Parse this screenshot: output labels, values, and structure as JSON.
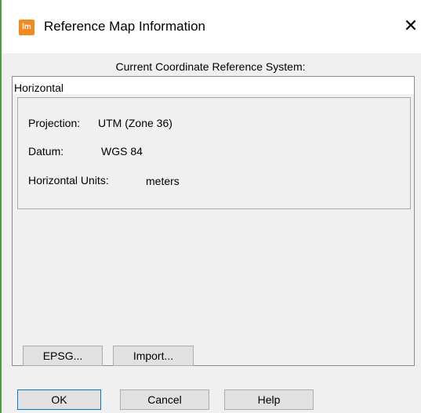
{
  "window": {
    "title": "Reference Map Information",
    "app_icon_text": "lm",
    "app_icon_color": "#f28a1e",
    "close_glyph": "✕"
  },
  "crs": {
    "caption": "Current Coordinate Reference System:",
    "section_label": "Horizontal",
    "projection_label": "Projection:",
    "projection_value": "UTM (Zone 36)",
    "datum_label": "Datum:",
    "datum_value": "WGS 84",
    "units_label": "Horizontal Units:",
    "units_value": "meters"
  },
  "panel_buttons": {
    "epsg_label": "EPSG...",
    "import_label": "Import..."
  },
  "dialog_buttons": {
    "ok_label": "OK",
    "cancel_label": "Cancel",
    "help_label": "Help"
  },
  "colors": {
    "accent": "#0078d7",
    "window_bg": "#f0f0f0",
    "side_accent": "#4aa03c"
  }
}
